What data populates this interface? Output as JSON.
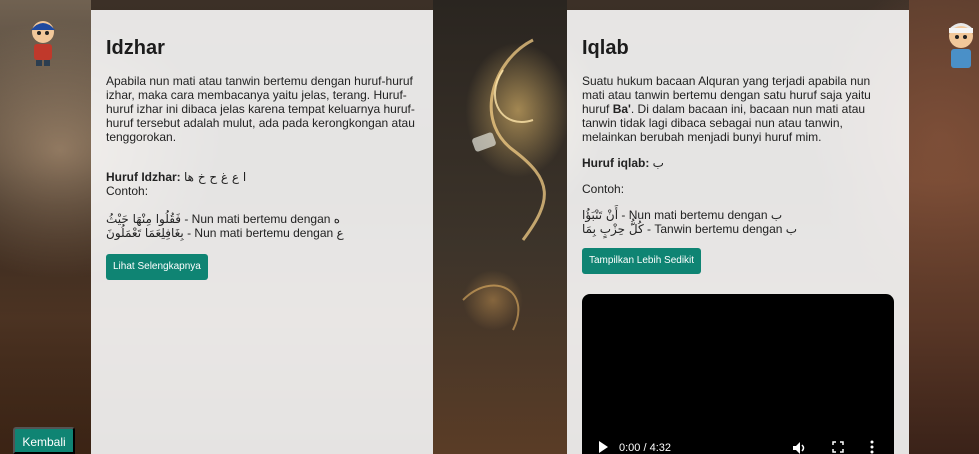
{
  "left_card": {
    "title": "Idzhar",
    "description": "Apabila nun mati atau tanwin bertemu dengan huruf-huruf izhar, maka cara membacanya yaitu jelas, terang. Huruf-huruf izhar ini dibaca jelas karena tempat keluarnya huruf-huruf tersebut adalah mulut, ada pada kerongkongan atau tenggorokan.",
    "letters_label": "Huruf Idzhar:",
    "letters": "ا ع غ ح خ ها",
    "example_label": "Contoh:",
    "examples": [
      {
        "arabic": "فَقُلُوا مِنْهَا حَيْثُ",
        "text": " - Nun mati bertemu dengan ه"
      },
      {
        "arabic": "بِغَافِلِعَمَا تَعْمَلُونَ",
        "text": " - Nun mati bertemu dengan ع"
      }
    ],
    "button_label": "Lihat Selengkapnya"
  },
  "right_card": {
    "title": "Iqlab",
    "description_before": "Suatu hukum bacaan Alquran yang terjadi apabila nun mati atau tanwin bertemu dengan satu huruf saja yaitu huruf ",
    "description_bold": "Ba'",
    "description_after": ". Di dalam bacaan ini, bacaan nun mati atau tanwin tidak lagi dibaca sebagai nun atau tanwin, melainkan berubah menjadi bunyi huruf mim.",
    "letters_label": "Huruf iqlab:",
    "letters": "ب",
    "example_label": "Contoh:",
    "examples": [
      {
        "arabic": "أَنْ تَنْبَؤُا",
        "text": " - Nun mati bertemu dengan ب"
      },
      {
        "arabic": "كُلُّ حِزْبٍ بِمَا",
        "text": " - Tanwin bertemu dengan ب"
      }
    ],
    "button_label": "Tampilkan Lebih Sedikit",
    "video": {
      "time": "0:00 / 4:32",
      "progress": 0
    }
  },
  "back_button_label": "Kembali",
  "colors": {
    "accent": "#0f8473",
    "panel": "#ffffff",
    "video_bg": "#000000"
  },
  "icons": {
    "left_avatar": "cartoon-boy-avatar",
    "right_avatar": "cartoon-boy-avatar",
    "play": "play-icon",
    "volume": "volume-icon",
    "fullscreen": "fullscreen-icon",
    "more": "more-vertical-icon"
  }
}
